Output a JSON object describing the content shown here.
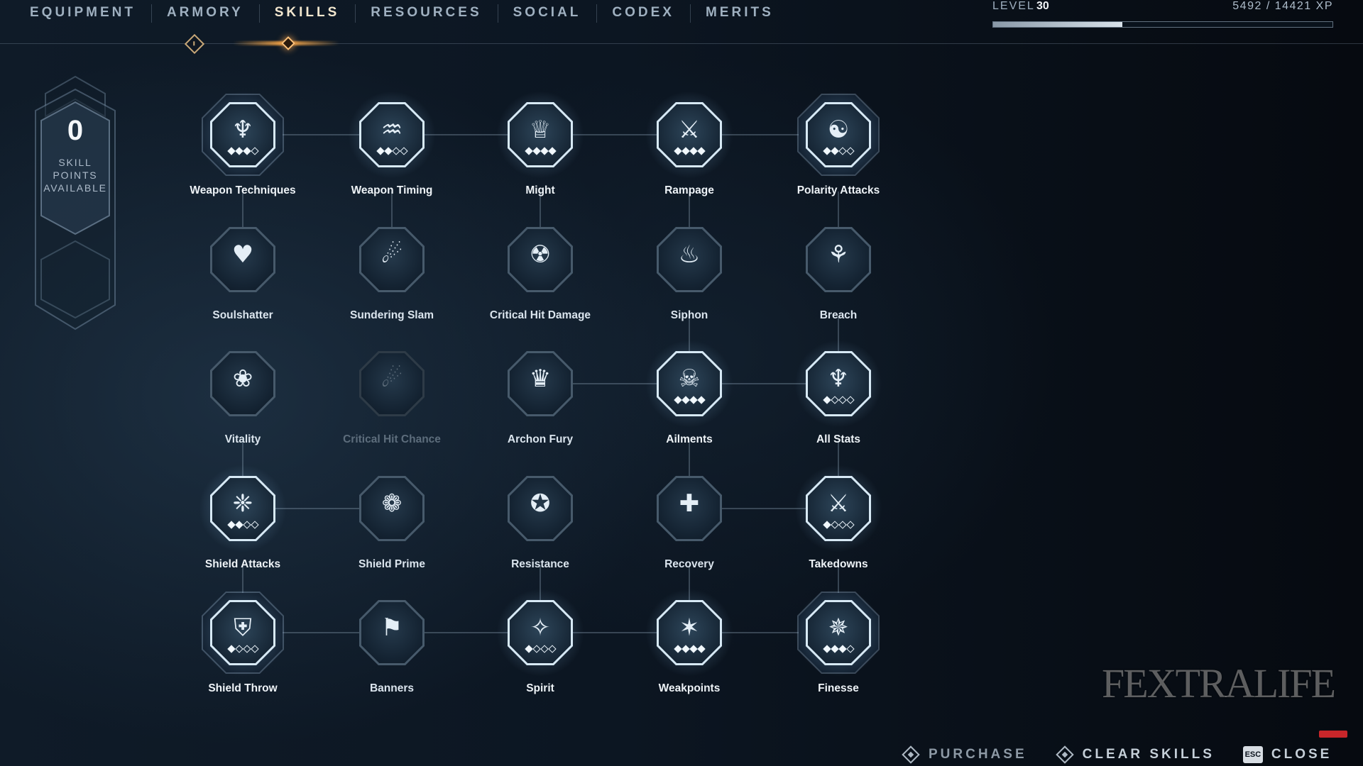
{
  "nav": {
    "tabs": [
      {
        "label": "EQUIPMENT",
        "active": false
      },
      {
        "label": "ARMORY",
        "active": false
      },
      {
        "label": "SKILLS",
        "active": true
      },
      {
        "label": "RESOURCES",
        "active": false
      },
      {
        "label": "SOCIAL",
        "active": false
      },
      {
        "label": "CODEX",
        "active": false
      },
      {
        "label": "MERITS",
        "active": false
      }
    ]
  },
  "level": {
    "label": "LEVEL",
    "value": "30",
    "xp_text": "5492 / 14421 XP",
    "xp_fraction": 0.381
  },
  "skill_points": {
    "value": "0",
    "label": "SKILL\nPOINTS\nAVAILABLE"
  },
  "skills": [
    {
      "id": "weapon-techniques",
      "label": "Weapon Techniques",
      "glyph": "♆",
      "state": "lit",
      "pips": 4,
      "filled": 3,
      "framed": true
    },
    {
      "id": "weapon-timing",
      "label": "Weapon Timing",
      "glyph": "♒",
      "state": "lit",
      "pips": 4,
      "filled": 2,
      "framed": false
    },
    {
      "id": "might",
      "label": "Might",
      "glyph": "♕",
      "state": "lit",
      "pips": 4,
      "filled": 4,
      "framed": false
    },
    {
      "id": "rampage",
      "label": "Rampage",
      "glyph": "⚔",
      "state": "lit",
      "pips": 4,
      "filled": 4,
      "framed": false
    },
    {
      "id": "polarity-attacks",
      "label": "Polarity Attacks",
      "glyph": "☯",
      "state": "lit",
      "pips": 4,
      "filled": 2,
      "framed": true
    },
    {
      "id": "soulshatter",
      "label": "Soulshatter",
      "glyph": "♥",
      "state": "base",
      "pips": 0,
      "filled": 0,
      "framed": false
    },
    {
      "id": "sundering-slam",
      "label": "Sundering Slam",
      "glyph": "☄",
      "state": "base",
      "pips": 0,
      "filled": 0,
      "framed": false
    },
    {
      "id": "critical-hit-damage",
      "label": "Critical Hit Damage",
      "glyph": "☢",
      "state": "base",
      "pips": 0,
      "filled": 0,
      "framed": false
    },
    {
      "id": "siphon",
      "label": "Siphon",
      "glyph": "♨",
      "state": "base",
      "pips": 0,
      "filled": 0,
      "framed": false
    },
    {
      "id": "breach",
      "label": "Breach",
      "glyph": "⚘",
      "state": "base",
      "pips": 0,
      "filled": 0,
      "framed": false
    },
    {
      "id": "vitality",
      "label": "Vitality",
      "glyph": "❀",
      "state": "base",
      "pips": 0,
      "filled": 0,
      "framed": false
    },
    {
      "id": "critical-hit-chance",
      "label": "Critical Hit Chance",
      "glyph": "☄",
      "state": "dim",
      "pips": 0,
      "filled": 0,
      "framed": false
    },
    {
      "id": "archon-fury",
      "label": "Archon Fury",
      "glyph": "♛",
      "state": "base",
      "pips": 0,
      "filled": 0,
      "framed": false
    },
    {
      "id": "ailments",
      "label": "Ailments",
      "glyph": "☠",
      "state": "lit",
      "pips": 4,
      "filled": 4,
      "framed": false
    },
    {
      "id": "all-stats",
      "label": "All Stats",
      "glyph": "♆",
      "state": "lit",
      "pips": 4,
      "filled": 1,
      "framed": false
    },
    {
      "id": "shield-attacks",
      "label": "Shield Attacks",
      "glyph": "❈",
      "state": "lit",
      "pips": 4,
      "filled": 2,
      "framed": false
    },
    {
      "id": "shield-prime",
      "label": "Shield Prime",
      "glyph": "❁",
      "state": "base",
      "pips": 0,
      "filled": 0,
      "framed": false
    },
    {
      "id": "resistance",
      "label": "Resistance",
      "glyph": "✪",
      "state": "base",
      "pips": 0,
      "filled": 0,
      "framed": false
    },
    {
      "id": "recovery",
      "label": "Recovery",
      "glyph": "✚",
      "state": "base",
      "pips": 0,
      "filled": 0,
      "framed": false
    },
    {
      "id": "takedowns",
      "label": "Takedowns",
      "glyph": "⚔",
      "state": "lit",
      "pips": 4,
      "filled": 1,
      "framed": false
    },
    {
      "id": "shield-throw",
      "label": "Shield Throw",
      "glyph": "⛨",
      "state": "lit",
      "pips": 4,
      "filled": 1,
      "framed": true
    },
    {
      "id": "banners",
      "label": "Banners",
      "glyph": "⚑",
      "state": "base",
      "pips": 0,
      "filled": 0,
      "framed": false
    },
    {
      "id": "spirit",
      "label": "Spirit",
      "glyph": "✧",
      "state": "lit",
      "pips": 4,
      "filled": 1,
      "framed": false
    },
    {
      "id": "weakpoints",
      "label": "Weakpoints",
      "glyph": "✶",
      "state": "lit",
      "pips": 4,
      "filled": 4,
      "framed": false
    },
    {
      "id": "finesse",
      "label": "Finesse",
      "glyph": "✵",
      "state": "lit",
      "pips": 4,
      "filled": 3,
      "framed": true
    }
  ],
  "watermark": "FEXTRALIFE",
  "footer": {
    "purchase": "PURCHASE",
    "clear_skills": "CLEAR SKILLS",
    "close_key": "ESC",
    "close": "CLOSE"
  }
}
